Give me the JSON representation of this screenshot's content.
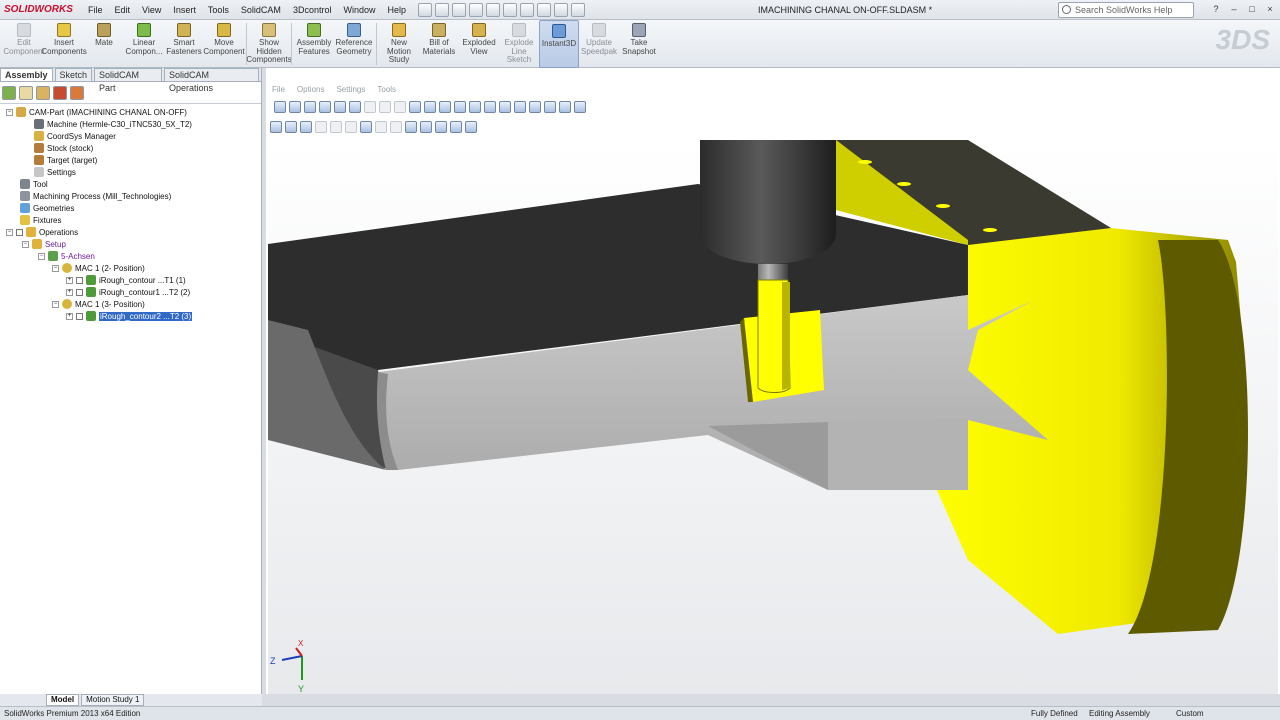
{
  "app": {
    "brand": "SOLIDWORKS",
    "document_title": "IMACHINING CHANAL ON-OFF.SLDASM *"
  },
  "menu": [
    "File",
    "Edit",
    "View",
    "Insert",
    "Tools",
    "SolidCAM",
    "3Dcontrol",
    "Window",
    "Help"
  ],
  "help_search": {
    "placeholder": "Search SolidWorks Help"
  },
  "commands": [
    {
      "label": "Edit\nComponent",
      "state": "disabled"
    },
    {
      "label": "Insert\nComponents",
      "state": "enabled"
    },
    {
      "label": "Mate",
      "state": "enabled"
    },
    {
      "label": "Linear\nCompon...",
      "state": "enabled"
    },
    {
      "label": "Smart\nFasteners",
      "state": "enabled"
    },
    {
      "label": "Move\nComponent",
      "state": "enabled"
    },
    {
      "label": "Show\nHidden\nComponents",
      "state": "enabled"
    },
    {
      "label": "Assembly\nFeatures",
      "state": "enabled"
    },
    {
      "label": "Reference\nGeometry",
      "state": "enabled"
    },
    {
      "label": "New\nMotion\nStudy",
      "state": "enabled"
    },
    {
      "label": "Bill of\nMaterials",
      "state": "enabled"
    },
    {
      "label": "Exploded\nView",
      "state": "enabled"
    },
    {
      "label": "Explode\nLine\nSketch",
      "state": "disabled"
    },
    {
      "label": "Instant3D",
      "state": "active"
    },
    {
      "label": "Update\nSpeedpak",
      "state": "disabled"
    },
    {
      "label": "Take\nSnapshot",
      "state": "enabled"
    }
  ],
  "tabs": [
    "Assembly",
    "Sketch",
    "SolidCAM Part",
    "SolidCAM Operations"
  ],
  "active_tab": "Assembly",
  "tree": [
    {
      "label": "CAM-Part (IMACHINING CHANAL ON-OFF)",
      "icon": "cam-part-icon"
    },
    {
      "label": "Machine (Hermle-C30_iTNC530_5X_T2)",
      "icon": "machine-icon"
    },
    {
      "label": "CoordSys Manager",
      "icon": "coordsys-icon"
    },
    {
      "label": "Stock (stock)",
      "icon": "stock-icon"
    },
    {
      "label": "Target (target)",
      "icon": "target-icon"
    },
    {
      "label": "Settings",
      "icon": "settings-icon"
    },
    {
      "label": "Tool",
      "icon": "tool-icon"
    },
    {
      "label": "Machining Process (Mill_Technologies)",
      "icon": "process-icon"
    },
    {
      "label": "Geometries",
      "icon": "geometries-icon"
    },
    {
      "label": "Fixtures",
      "icon": "fixtures-icon"
    },
    {
      "label": "Operations",
      "icon": "operations-icon"
    },
    {
      "label": "Setup",
      "icon": "setup-icon"
    },
    {
      "label": "5-Achsen",
      "icon": "axes-icon"
    },
    {
      "label": "MAC 1 (2- Position)",
      "icon": "mac-icon"
    },
    {
      "label": "iRough_contour ...T1 (1)",
      "icon": "op-icon"
    },
    {
      "label": "iRough_contour1 ...T2 (2)",
      "icon": "op-icon"
    },
    {
      "label": "MAC 1 (3- Position)",
      "icon": "mac-icon"
    },
    {
      "label": "iRough_contour2 ...T2 (3)",
      "icon": "op-icon",
      "selected": true
    }
  ],
  "viewport_menu": [
    "File",
    "Options",
    "Settings",
    "Tools"
  ],
  "triad": {
    "x": "X",
    "y": "Y",
    "z": "Z"
  },
  "bottom_tabs": [
    "Model",
    "Motion Study 1"
  ],
  "status": {
    "left": "SolidWorks Premium 2013 x64 Edition",
    "definition": "Fully Defined",
    "mode": "Editing Assembly",
    "units": "Custom"
  },
  "colors": {
    "part": "#ffff00",
    "stock": "#bfbfbf",
    "fixture_top": "#2f2f2f",
    "tool": "#3a3a3a"
  }
}
